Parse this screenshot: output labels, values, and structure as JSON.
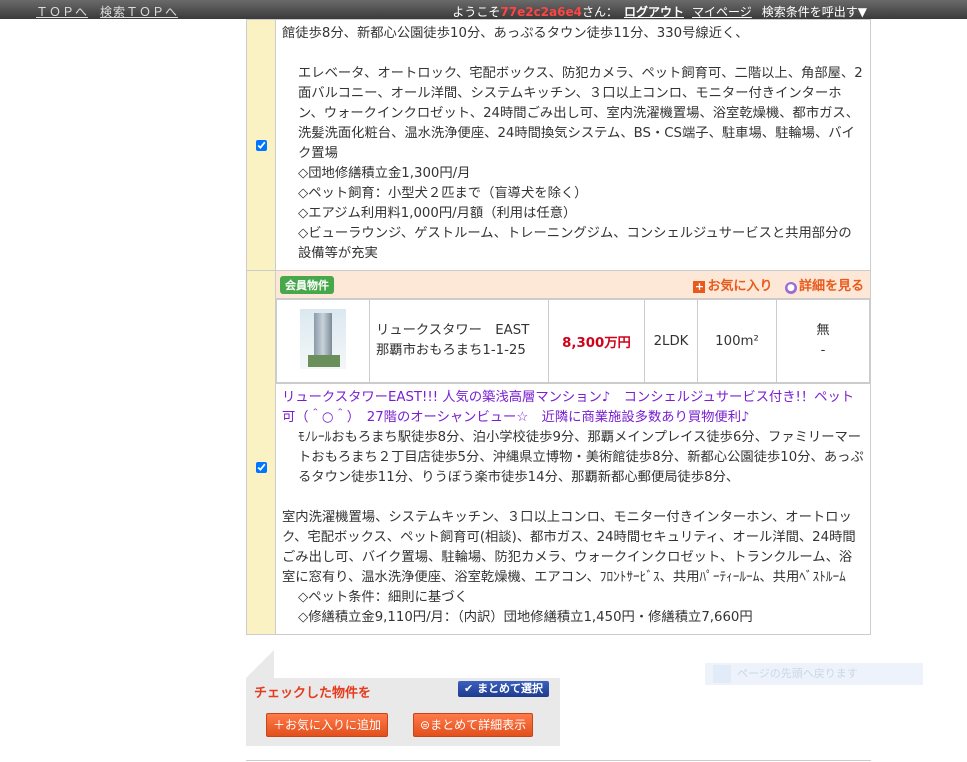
{
  "topbar": {
    "top_link": "ＴＯＰへ",
    "search_top_link": "検索ＴＯＰへ",
    "welcome_prefix": "ようこそ",
    "user_id": "77e2c2a6e4",
    "welcome_suffix": "さん：",
    "logout": "ログアウト",
    "mypage": "マイページ",
    "recall_conditions": "検索条件を呼出す▼"
  },
  "listing1": {
    "checked": true,
    "access_line": "館徒歩8分、新都心公園徒歩10分、あっぷるタウン徒歩11分、330号線近く、",
    "features": "エレベータ、オートロック、宅配ボックス、防犯カメラ、ペット飼育可、二階以上、角部屋、2面バルコニー、オール洋間、システムキッチン、３口以上コンロ、モニター付きインターホン、ウォークインクロゼット、24時間ごみ出し可、室内洗濯機置場、浴室乾燥機、都市ガス、洗髪洗面化粧台、温水洗浄便座、24時間換気システム、BS・CS端子、駐車場、駐輪場、バイク置場",
    "notes": [
      "◇団地修繕積立金1,300円/月",
      "◇ペット飼育：小型犬２匹まで（盲導犬を除く）",
      "◇エアジム利用料1,000円/月額（利用は任意）",
      "◇ビューラウンジ、ゲストルーム、トレーニングジム、コンシェルジュサービスと共用部分の設備等が充実"
    ]
  },
  "listing2": {
    "badge": "会員物件",
    "favorite_label": "お気に入り",
    "detail_label": "詳細を見る",
    "name": "リュークスタワー　EAST",
    "address": "那覇市おもろまち1-1-25",
    "price": "8,300万円",
    "layout": "2LDK",
    "area": "100m²",
    "parking": "無",
    "parking_sub": "-",
    "checked": true,
    "catchcopy": "リュークスタワーEAST!!! 人気の築浅高層マンション♪　コンシェルジュサービス付き!！ペット可（＾○＾）　27階のオーシャンビュー☆　近隣に商業施設多数あり買物便利♪",
    "access": "ﾓﾉﾚｰﾙおもろまち駅徒歩8分、泊小学校徒歩9分、那覇メインプレイス徒歩6分、ファミリーマートおもろまち２丁目店徒歩5分、沖縄県立博物・美術館徒歩8分、新都心公園徒歩10分、あっぷるタウン徒歩11分、りうぼう楽市徒歩14分、那覇新都心郵便局徒歩8分、",
    "features": "室内洗濯機置場、システムキッチン、３口以上コンロ、モニター付きインターホン、オートロック、宅配ボックス、ペット飼育可(相談)、都市ガス、24時間セキュリティ、オール洋間、24時間ごみ出し可、バイク置場、駐輪場、防犯カメラ、ウォークインクロゼット、トランクルーム、浴室に窓有り、温水洗浄便座、浴室乾燥機、エアコン、ﾌﾛﾝﾄｻｰﾋﾞｽ、共用ﾊﾟｰﾃｨｰﾙｰﾑ、共用ﾍﾞｽﾄﾙｰﾑ",
    "notes": [
      "◇ペット条件：細則に基づく",
      "◇修繕積立金9,110円/月：（内訳）団地修繕積立1,450円・修繕積立7,660円"
    ]
  },
  "panel": {
    "title": "チェックした物件を",
    "select_all": "まとめて選択",
    "add_favorites": "お気に入りに追加",
    "show_details": "まとめて詳細表示"
  },
  "hint": {
    "text": "ページの先頭へ戻ります"
  }
}
